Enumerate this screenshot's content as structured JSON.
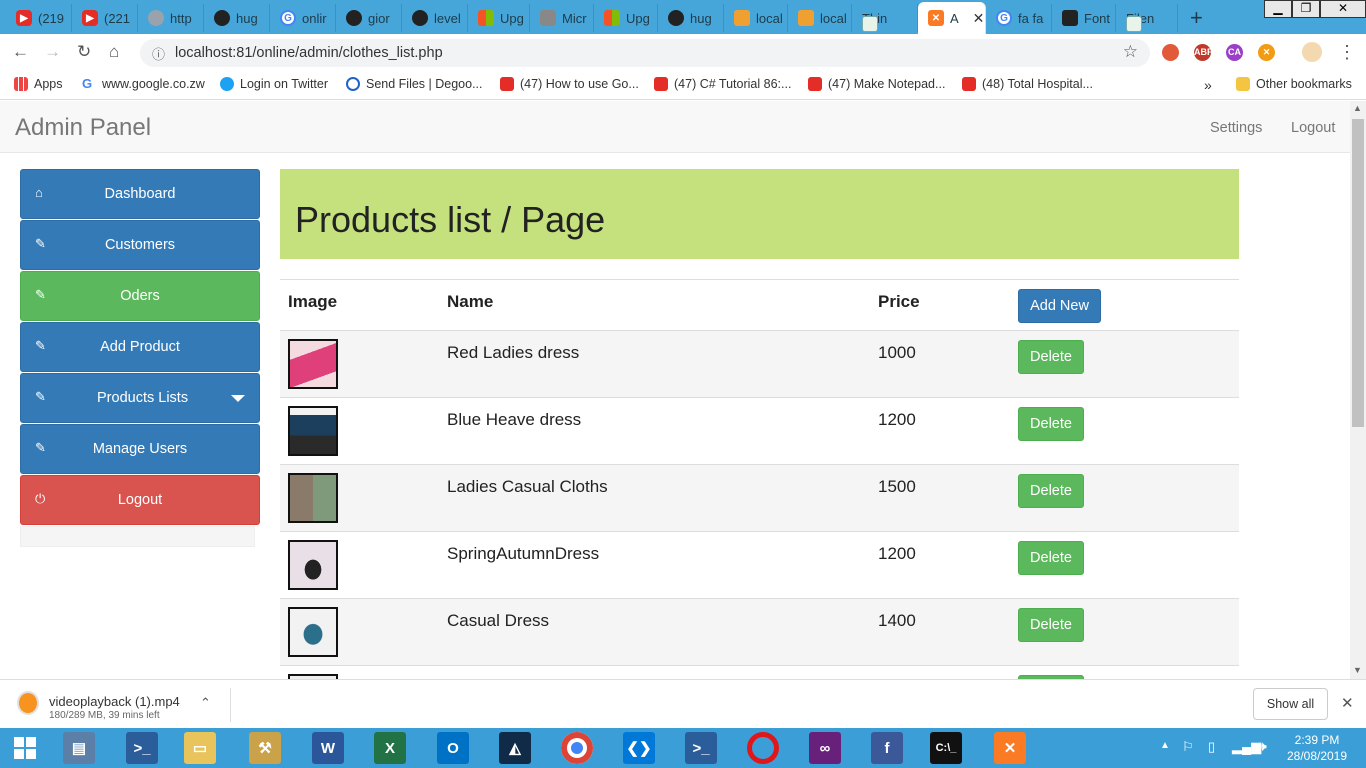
{
  "browser": {
    "tabs": [
      {
        "label": "(219",
        "icon": "youtube-icon"
      },
      {
        "label": "(221",
        "icon": "youtube-icon"
      },
      {
        "label": "http",
        "icon": "globe-icon"
      },
      {
        "label": "hug",
        "icon": "github-icon"
      },
      {
        "label": "onlir",
        "icon": "google-icon"
      },
      {
        "label": "gior",
        "icon": "github-icon"
      },
      {
        "label": "level",
        "icon": "github-icon"
      },
      {
        "label": "Upg",
        "icon": "microsoft-icon"
      },
      {
        "label": "Micr",
        "icon": "microsoft-icon"
      },
      {
        "label": "Upg",
        "icon": "microsoft-icon"
      },
      {
        "label": "hug",
        "icon": "github-icon"
      },
      {
        "label": "local",
        "icon": "phpmyadmin-icon"
      },
      {
        "label": "local",
        "icon": "phpmyadmin-icon"
      },
      {
        "label": "Thin",
        "icon": "page-icon"
      },
      {
        "label": "A",
        "icon": "xampp-icon",
        "active": true
      },
      {
        "label": "fa fa",
        "icon": "google-icon"
      },
      {
        "label": "Font",
        "icon": "fontawesome-icon"
      },
      {
        "label": "Filen",
        "icon": "page-icon"
      }
    ],
    "url": "localhost:81/online/admin/clothes_list.php",
    "bookmarks": [
      {
        "label": "Apps"
      },
      {
        "label": "www.google.co.zw"
      },
      {
        "label": "Login on Twitter"
      },
      {
        "label": "Send Files | Degoo..."
      },
      {
        "label": "(47) How to use Go..."
      },
      {
        "label": "(47) C# Tutorial 86:..."
      },
      {
        "label": "(47) Make Notepad..."
      },
      {
        "label": "(48) Total Hospital..."
      }
    ],
    "bookmarks_more": "»",
    "other_bookmarks": "Other bookmarks"
  },
  "app": {
    "brand": "Admin Panel",
    "nav": {
      "settings": "Settings",
      "logout": "Logout"
    },
    "sidebar": [
      {
        "label": "Dashboard",
        "icon": "home-icon",
        "color": "#337ab7"
      },
      {
        "label": "Customers",
        "icon": "edit-icon",
        "color": "#337ab7"
      },
      {
        "label": "Oders",
        "icon": "edit-icon",
        "color": "#5cb85c"
      },
      {
        "label": "Add Product",
        "icon": "edit-icon",
        "color": "#337ab7"
      },
      {
        "label": "Products Lists",
        "icon": "edit-icon",
        "color": "#337ab7",
        "dropdown": true
      },
      {
        "label": "Manage Users",
        "icon": "edit-icon",
        "color": "#337ab7"
      },
      {
        "label": "Logout",
        "icon": "power-icon",
        "color": "#d9534f"
      }
    ],
    "jumbotron_title": "Products list / Page",
    "table": {
      "headers": {
        "image": "Image",
        "name": "Name",
        "price": "Price"
      },
      "add_new": "Add New",
      "delete_label": "Delete",
      "rows": [
        {
          "name": "Red Ladies dress",
          "price": "1000"
        },
        {
          "name": "Blue Heave dress",
          "price": "1200"
        },
        {
          "name": "Ladies Casual Cloths",
          "price": "1500"
        },
        {
          "name": "SpringAutumnDress",
          "price": "1200"
        },
        {
          "name": "Casual Dress",
          "price": "1400"
        }
      ]
    }
  },
  "download": {
    "filename": "videoplayback (1).mp4",
    "status": "180/289 MB, 39 mins left",
    "show_all": "Show all"
  },
  "taskbar": {
    "time": "2:39 PM",
    "date": "28/08/2019"
  },
  "colors": {
    "jumbotron": "#c5e17e",
    "primary": "#337ab7",
    "success": "#5cb85c",
    "danger": "#d9534f",
    "tabstrip": "#47a6d9",
    "taskbar": "#3b9ed6"
  }
}
